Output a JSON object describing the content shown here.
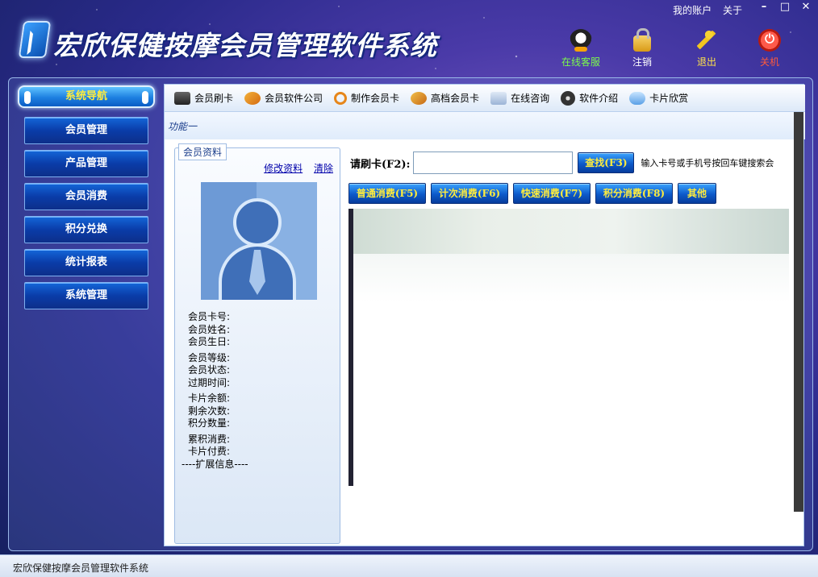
{
  "app": {
    "title": "宏欣保健按摩会员管理软件系统",
    "status_text": "宏欣保健按摩会员管理软件系统"
  },
  "top_links": {
    "account": "我的账户",
    "about": "关于"
  },
  "window_controls": {
    "minimize": "–",
    "maximize": "□",
    "close": "✕"
  },
  "top_tools": [
    {
      "label": "在线客服",
      "icon": "qq-icon",
      "color": "#7cfc4a"
    },
    {
      "label": "注销",
      "icon": "lock-icon",
      "color": "#ffffff"
    },
    {
      "label": "退出",
      "icon": "running-man-icon",
      "color": "#ffe34a"
    },
    {
      "label": "关机",
      "icon": "power-icon",
      "color": "#ff5a3c"
    }
  ],
  "sidebar": {
    "header": "系统导航",
    "items": [
      {
        "label": "会员管理"
      },
      {
        "label": "产品管理"
      },
      {
        "label": "会员消费"
      },
      {
        "label": "积分兑换"
      },
      {
        "label": "统计报表"
      },
      {
        "label": "系统管理"
      }
    ]
  },
  "toolbar": {
    "items": [
      {
        "label": "会员刷卡",
        "icon": "card-reader-icon"
      },
      {
        "label": "会员软件公司",
        "icon": "hand-icon"
      },
      {
        "label": "制作会员卡",
        "icon": "refresh-ring-icon"
      },
      {
        "label": "高档会员卡",
        "icon": "hand-card-icon"
      },
      {
        "label": "在线咨询",
        "icon": "mail-icon"
      },
      {
        "label": "软件介绍",
        "icon": "disc-icon"
      },
      {
        "label": "卡片欣赏",
        "icon": "cloud-icon"
      }
    ]
  },
  "function_tab": "功能一",
  "member": {
    "legend": "会员资料",
    "edit_link": "修改资料",
    "clear_link": "清除",
    "fields": {
      "card_no": "会员卡号:",
      "name": "会员姓名:",
      "birthday": "会员生日:",
      "level": "会员等级:",
      "status": "会员状态:",
      "expire": "过期时间:",
      "balance": "卡片余额:",
      "remaining": "剩余次数:",
      "points": "积分数量:",
      "total_consume": "累积消费:",
      "card_paid": "卡片付费:",
      "ext": "----扩展信息----"
    }
  },
  "swipe": {
    "label": "请刷卡(F2):",
    "input_value": "",
    "search_button": "查找(F3)",
    "hint": "输入卡号或手机号按回车键搜索会"
  },
  "consume_buttons": [
    {
      "label": "普通消费(F5)"
    },
    {
      "label": "计次消费(F6)"
    },
    {
      "label": "快速消费(F7)"
    },
    {
      "label": "积分消费(F8)"
    },
    {
      "label": "其他"
    }
  ]
}
